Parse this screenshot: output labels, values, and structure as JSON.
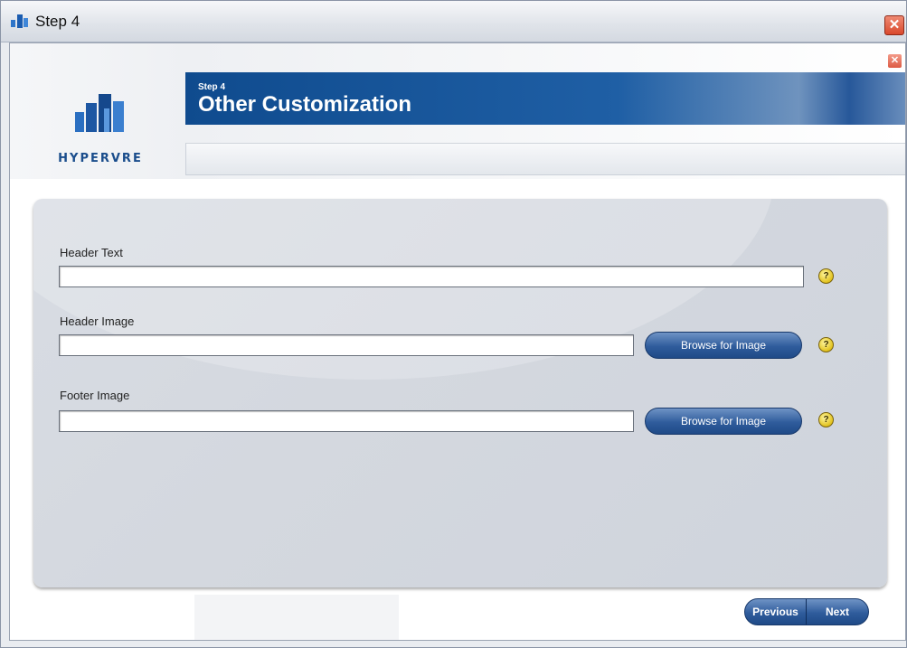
{
  "window": {
    "title": "Step 4",
    "close_glyph": "✕"
  },
  "header": {
    "logo_text": "HYPERVRE",
    "step_label": "Step 4",
    "title": "Other Customization",
    "close_glyph": "✕"
  },
  "form": {
    "header_text": {
      "label": "Header Text",
      "value": ""
    },
    "header_image": {
      "label": "Header Image",
      "value": "",
      "button_label": "Browse for Image"
    },
    "footer_image": {
      "label": "Footer Image",
      "value": "",
      "button_label": "Browse for Image"
    },
    "help_glyph": "?"
  },
  "nav": {
    "previous_label": "Previous",
    "next_label": "Next"
  },
  "colors": {
    "banner": "#1f5fa5",
    "button": "#2f5c9c",
    "help": "#e2c21d",
    "close": "#d9482c"
  },
  "icons": [
    "app-icon",
    "close-icon",
    "hypervre-logo-icon",
    "help-icon"
  ]
}
